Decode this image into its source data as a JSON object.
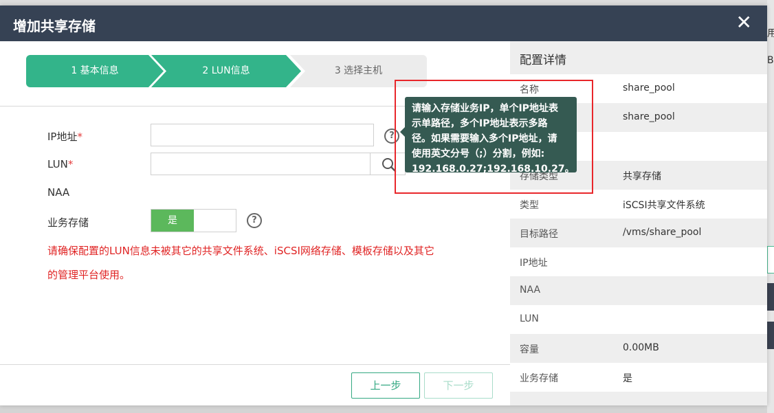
{
  "dialog": {
    "title": "增加共享存储",
    "close_glyph": "✕"
  },
  "steps": [
    {
      "label": "1 基本信息"
    },
    {
      "label": "2 LUN信息"
    },
    {
      "label": "3 选择主机"
    }
  ],
  "form": {
    "ip_label": "IP地址",
    "lun_label": "LUN",
    "required_mark": "*",
    "naa_label": "NAA",
    "business_label": "业务存储",
    "ip_value": "",
    "lun_value": "",
    "toggle_on_label": "是",
    "help_glyph": "?",
    "warning_line1": "请确保配置的LUN信息未被其它的共享文件系统、iSCSI网络存储、模板存储以及其它",
    "warning_line2": "的管理平台使用。"
  },
  "tooltip": {
    "lines": [
      "请输入存储业务IP，单个IP地址表",
      "示单路径，多个IP地址表示多路",
      "径。如果需要输入多个IP地址，请",
      "使用英文分号（;）分割，例如:",
      "192.168.0.27;192.168.10.27。"
    ]
  },
  "footer": {
    "prev_label": "上一步",
    "next_label": "下一步"
  },
  "details": {
    "title": "配置详情",
    "rows": [
      {
        "key": "名称",
        "value": "share_pool"
      },
      {
        "key": "",
        "value": "share_pool"
      },
      {
        "key": "",
        "value": ""
      },
      {
        "key": "存储类型",
        "value": "共享存储"
      },
      {
        "key": "类型",
        "value": "iSCSI共享文件系统"
      },
      {
        "key": "目标路径",
        "value": "/vms/share_pool"
      },
      {
        "key": "IP地址",
        "value": ""
      },
      {
        "key": "NAA",
        "value": ""
      },
      {
        "key": "LUN",
        "value": ""
      },
      {
        "key": "容量",
        "value": "0.00MB"
      },
      {
        "key": "业务存储",
        "value": "是"
      }
    ]
  },
  "background": {
    "edge_text_1": "用",
    "edge_text_2": "B"
  },
  "colors": {
    "header": "#364254",
    "step_active": "#33b48a",
    "toggle_on": "#5cb85c",
    "warning": "#e02424",
    "tooltip": "#355a52",
    "highlight_box": "#e8262a"
  }
}
